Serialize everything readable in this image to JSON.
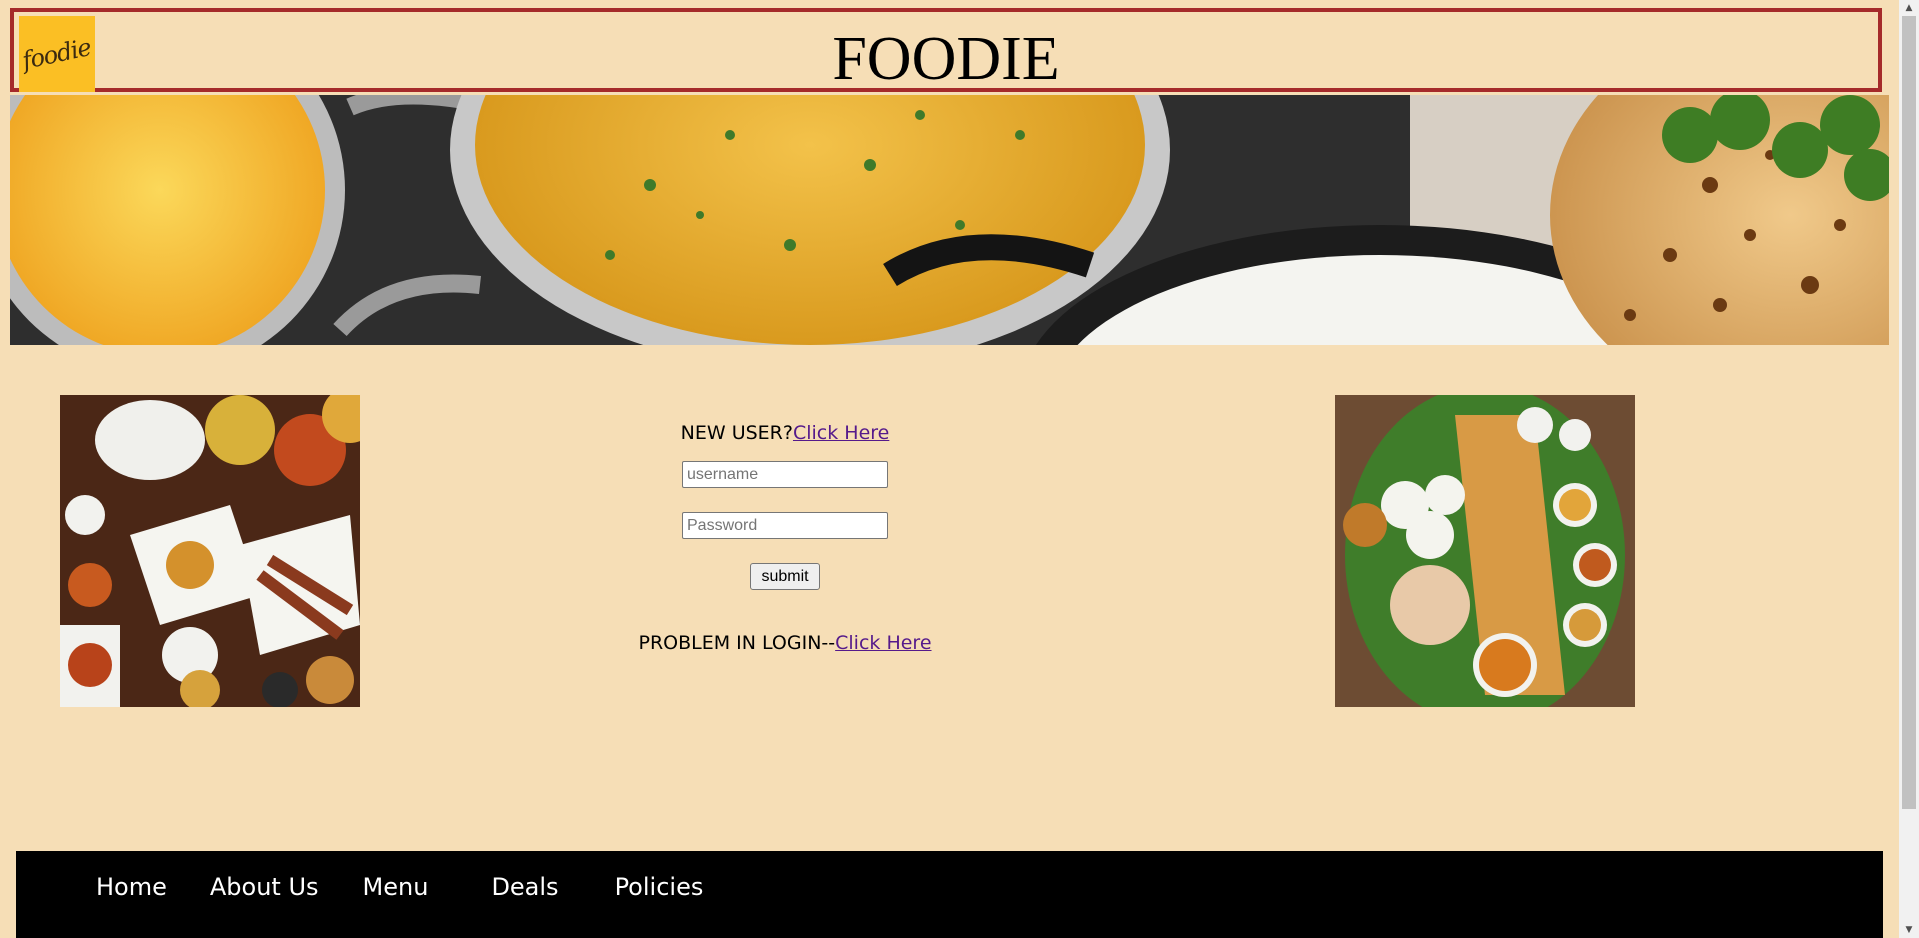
{
  "header": {
    "logo_text": "foodie",
    "title": "FOODIE"
  },
  "login": {
    "new_user_text": "NEW USER?",
    "new_user_link": "Click Here",
    "username_placeholder": "username",
    "password_placeholder": "Password",
    "submit_label": "submit",
    "problem_text": "PROBLEM IN LOGIN--",
    "problem_link": "Click Here"
  },
  "nav": {
    "items": [
      "Home",
      "About Us",
      "Menu",
      "Deals",
      "Policies"
    ]
  },
  "colors": {
    "page_bg": "#f6deb6",
    "header_border": "#a52a2a",
    "logo_bg": "#fbbf24",
    "link": "#551a8b",
    "footer_bg": "#000000"
  },
  "icons": {
    "scroll_up": "triangle-up-icon",
    "scroll_down": "triangle-down-icon"
  }
}
